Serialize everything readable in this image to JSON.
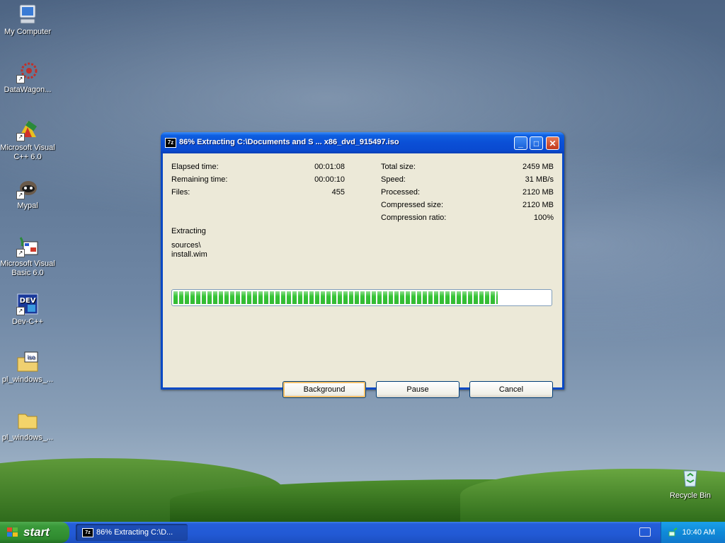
{
  "desktop": {
    "icons": [
      {
        "label": "My Computer",
        "icon": "computer-icon"
      },
      {
        "label": "DataWagon...",
        "icon": "datawagon-icon"
      },
      {
        "label": "Microsoft Visual C++ 6.0",
        "icon": "visual-cpp-icon"
      },
      {
        "label": "Mypal",
        "icon": "mypal-icon"
      },
      {
        "label": "Microsoft Visual Basic 6.0",
        "icon": "visual-basic-icon"
      },
      {
        "label": "Dev-C++",
        "icon": "dev-cpp-icon"
      },
      {
        "label": "pl_windows_...",
        "icon": "iso-file-icon"
      },
      {
        "label": "pl_windows_...",
        "icon": "folder-icon"
      }
    ],
    "recycle_bin": {
      "label": "Recycle Bin",
      "icon": "recycle-bin-icon"
    }
  },
  "dialog": {
    "title": "86% Extracting C:\\Documents and S ... x86_dvd_915497.iso",
    "icon_text": "7z",
    "stats_left": [
      {
        "label": "Elapsed time:",
        "value": "00:01:08"
      },
      {
        "label": "Remaining time:",
        "value": "00:00:10"
      },
      {
        "label": "Files:",
        "value": "455"
      }
    ],
    "stats_right": [
      {
        "label": "Total size:",
        "value": "2459 MB"
      },
      {
        "label": "Speed:",
        "value": "31 MB/s"
      },
      {
        "label": "Processed:",
        "value": "2120 MB"
      },
      {
        "label": "Compressed size:",
        "value": "2120 MB"
      },
      {
        "label": "Compression ratio:",
        "value": "100%"
      }
    ],
    "status": "Extracting",
    "current_path": "sources\\",
    "current_file": "install.wim",
    "progress_fraction": 0.86,
    "buttons": {
      "background": "Background",
      "pause": "Pause",
      "cancel": "Cancel"
    }
  },
  "taskbar": {
    "start_label": "start",
    "task_label": "86% Extracting C:\\D...",
    "clock": "10:40 AM"
  }
}
